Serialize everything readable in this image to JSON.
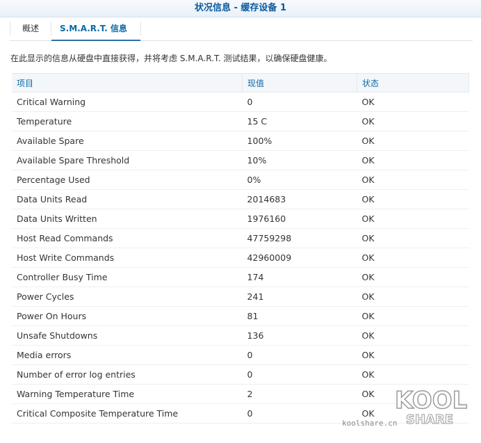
{
  "window": {
    "title": "状况信息 - 缓存设备 1"
  },
  "tabs": [
    {
      "label": "概述"
    },
    {
      "label": "S.M.A.R.T. 信息"
    }
  ],
  "description": "在此显示的信息从硬盘中直接获得，并将考虑 S.M.A.R.T. 测试结果，以确保硬盘健康。",
  "table": {
    "headers": [
      "项目",
      "现值",
      "状态"
    ],
    "rows": [
      [
        "Critical Warning",
        "0",
        "OK"
      ],
      [
        "Temperature",
        "15 C",
        "OK"
      ],
      [
        "Available Spare",
        "100%",
        "OK"
      ],
      [
        "Available Spare Threshold",
        "10%",
        "OK"
      ],
      [
        "Percentage Used",
        "0%",
        "OK"
      ],
      [
        "Data Units Read",
        "2014683",
        "OK"
      ],
      [
        "Data Units Written",
        "1976160",
        "OK"
      ],
      [
        "Host Read Commands",
        "47759298",
        "OK"
      ],
      [
        "Host Write Commands",
        "42960009",
        "OK"
      ],
      [
        "Controller Busy Time",
        "174",
        "OK"
      ],
      [
        "Power Cycles",
        "241",
        "OK"
      ],
      [
        "Power On Hours",
        "81",
        "OK"
      ],
      [
        "Unsafe Shutdowns",
        "136",
        "OK"
      ],
      [
        "Media errors",
        "0",
        "OK"
      ],
      [
        "Number of error log entries",
        "0",
        "OK"
      ],
      [
        "Warning Temperature Time",
        "2",
        "OK"
      ],
      [
        "Critical Composite Temperature Time",
        "0",
        "OK"
      ]
    ]
  },
  "watermark": {
    "logo": "KOOLSHARE",
    "site": "koolshare.cn"
  }
}
